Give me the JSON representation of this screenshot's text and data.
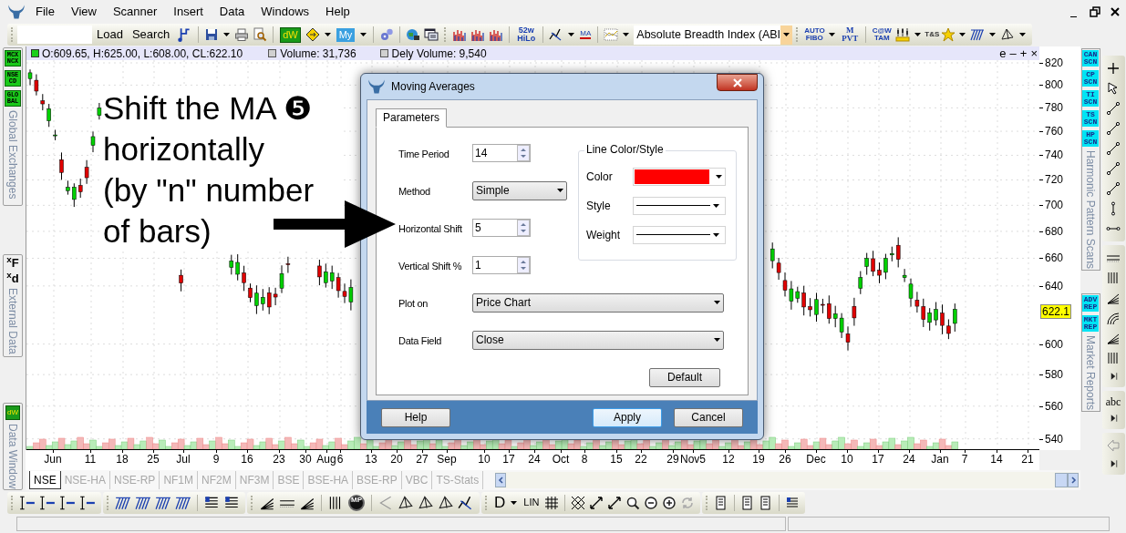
{
  "menu": [
    "File",
    "View",
    "Scanner",
    "Insert",
    "Data",
    "Windows",
    "Help"
  ],
  "toolbar": {
    "buttons": [
      "Load",
      "Search"
    ],
    "badges": [
      "dW",
      "My",
      "52w HiLo",
      "MA",
      "AUTO FIBO",
      "M PVT",
      "C@W TAM",
      "T&S"
    ],
    "indicator_select": "Absolute Breadth Index (ABI"
  },
  "left_panel": {
    "exchange_badges": [
      "MCX NCX",
      "NSE CD",
      "GLO BAL"
    ],
    "exchange_tab": "Global Exchanges",
    "external_icons": [
      "$^{x}$F",
      "$^{x}$d"
    ],
    "external_tab": "External Data",
    "data_window_badge": "dW",
    "data_window_tab": "Data Window"
  },
  "chart": {
    "ohlc": "O:609.65, H:625.00, L:608.00, CL:622.10",
    "volume": "Volume: 31,736",
    "delivery_volume": "Dely Volume: 9,540",
    "pane_buttons": [
      "e",
      "–",
      "+",
      "×"
    ],
    "yticks": [
      "820",
      "800",
      "780",
      "760",
      "740",
      "720",
      "700",
      "680",
      "660",
      "640",
      "600",
      "580",
      "560",
      "540"
    ],
    "last_price": "622.1",
    "xticks": [
      "Jun",
      "11",
      "18",
      "25",
      "Jul",
      "9",
      "16",
      "23",
      "30",
      "Aug",
      "6",
      "13",
      "20",
      "27",
      "Sep",
      "10",
      "17",
      "24",
      "Oct",
      "8",
      "15",
      "22",
      "29",
      "Nov5",
      "12",
      "19",
      "26",
      "Dec",
      "10",
      "17",
      "24",
      "Jan",
      "7",
      "14",
      "21"
    ]
  },
  "annotation": "Shift the MA ❺\nhorizontally\n(by \"n\" number\nof bars)",
  "exchange_tabs": [
    {
      "label": "NSE",
      "selected": true
    },
    {
      "label": "NSE-HA",
      "selected": false
    },
    {
      "label": "NSE-RP",
      "selected": false
    },
    {
      "label": "NF1M",
      "selected": false
    },
    {
      "label": "NF2M",
      "selected": false
    },
    {
      "label": "NF3M",
      "selected": false
    },
    {
      "label": "BSE",
      "selected": false
    },
    {
      "label": "BSE-HA",
      "selected": false
    },
    {
      "label": "BSE-RP",
      "selected": false
    },
    {
      "label": "VBC",
      "selected": false
    },
    {
      "label": "TS-Stats",
      "selected": false
    }
  ],
  "right_panel": {
    "scan_badges": [
      "CAN SCN",
      "CP SCN",
      "TI SCN",
      "TS SCN",
      "HP SCN"
    ],
    "scan_tab": "Harmonic Pattern Scans",
    "report_badges": [
      "ADV REP",
      "MKT REP"
    ],
    "report_tab": "Market Reports",
    "text_tool": "abc"
  },
  "bottom_toolbar": {
    "badges": [
      "MP",
      "D",
      "LIN"
    ]
  },
  "dialog": {
    "title": "Moving Averages",
    "tabs": [
      {
        "label": "Parameters",
        "selected": true
      }
    ],
    "fields": [
      {
        "kind": "spin",
        "label": "Time Period",
        "value": "14"
      },
      {
        "kind": "select",
        "label": "Method",
        "value": "Simple"
      },
      {
        "kind": "spin",
        "label": "Horizontal Shift",
        "value": "5"
      },
      {
        "kind": "spin",
        "label": "Vertical Shift %",
        "value": "1"
      }
    ],
    "wide_fields": [
      {
        "label": "Plot on",
        "value": "Price Chart"
      },
      {
        "label": "Data Field",
        "value": "Close"
      }
    ],
    "line_group": {
      "title": "Line Color/Style",
      "color_label": "Color",
      "color": "#ff0000",
      "style_label": "Style",
      "weight_label": "Weight"
    },
    "default_button": "Default",
    "footer_buttons": [
      {
        "label": "Help",
        "focused": false
      },
      {
        "label": "Apply",
        "focused": true
      },
      {
        "label": "Cancel",
        "focused": false
      }
    ]
  }
}
